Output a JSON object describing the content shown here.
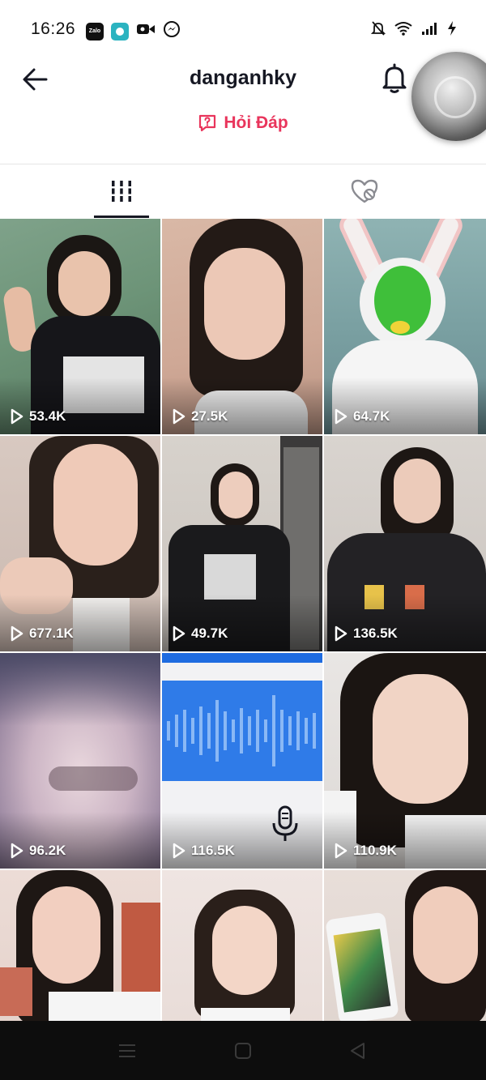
{
  "status_bar": {
    "time": "16:26",
    "app_icons": [
      "zalo-icon",
      "app-icon",
      "video-icon",
      "messenger-icon"
    ],
    "right_icons": [
      "mute-icon",
      "wifi-icon",
      "signal-icon",
      "charging-icon"
    ],
    "zalo_label": "Zalo"
  },
  "header": {
    "username": "danganhky",
    "qa_label": "Hỏi Đáp",
    "accent_color": "#e9355c"
  },
  "tabs": [
    {
      "name": "videos",
      "icon": "grid-icon",
      "active": true
    },
    {
      "name": "liked",
      "icon": "heart-hidden-icon",
      "active": false
    }
  ],
  "videos": [
    {
      "views": "53.4K"
    },
    {
      "views": "27.5K"
    },
    {
      "views": "64.7K"
    },
    {
      "views": "677.1K"
    },
    {
      "views": "49.7K"
    },
    {
      "views": "136.5K"
    },
    {
      "views": "96.2K"
    },
    {
      "views": "116.5K"
    },
    {
      "views": "110.9K"
    },
    {
      "views": ""
    },
    {
      "views": ""
    },
    {
      "views": ""
    }
  ],
  "system_nav": [
    "menu-icon",
    "home-icon",
    "back-triangle-icon"
  ]
}
